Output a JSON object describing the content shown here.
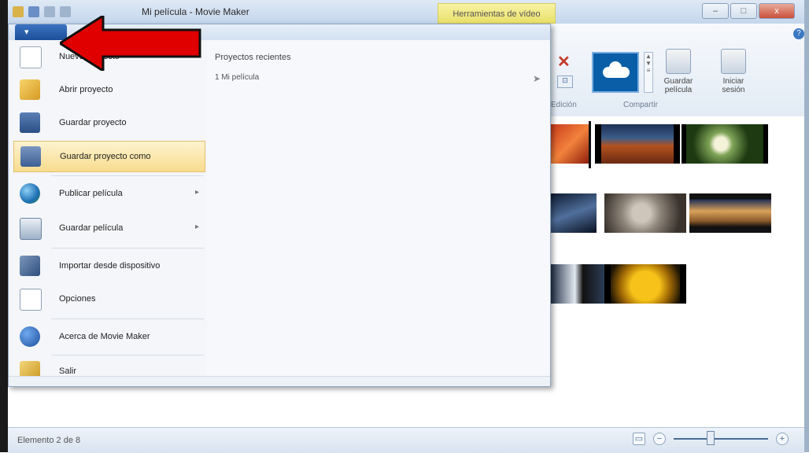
{
  "window": {
    "title": "Mi película - Movie Maker",
    "contextual_tab": "Herramientas de vídeo",
    "controls": {
      "minimize": "–",
      "maximize": "□",
      "close": "x"
    },
    "help_icon": "help-icon"
  },
  "ribbon": {
    "share_group_label": "Compartir",
    "edit_group_label": "Edición",
    "save_movie_button": "Guardar película",
    "sign_in_button": "Iniciar sesión",
    "onedrive_icon": "onedrive-icon"
  },
  "app_menu": {
    "button_label": "▾",
    "items": [
      {
        "label": "Nuevo proyecto",
        "icon": "new-project-icon",
        "has_submenu": false
      },
      {
        "label": "Abrir proyecto",
        "icon": "open-project-icon",
        "has_submenu": false
      },
      {
        "label": "Guardar proyecto",
        "icon": "save-project-icon",
        "has_submenu": false
      },
      {
        "label": "Guardar proyecto como",
        "icon": "save-as-icon",
        "has_submenu": false,
        "highlighted": true
      },
      {
        "label": "Publicar película",
        "icon": "publish-globe-icon",
        "has_submenu": true
      },
      {
        "label": "Guardar película",
        "icon": "save-movie-icon",
        "has_submenu": true
      },
      {
        "label": "Importar desde dispositivo",
        "icon": "import-device-icon",
        "has_submenu": false
      },
      {
        "label": "Opciones",
        "icon": "options-icon",
        "has_submenu": false
      },
      {
        "label": "Acerca de Movie Maker",
        "icon": "info-icon",
        "has_submenu": false
      },
      {
        "label": "Salir",
        "icon": "exit-icon",
        "has_submenu": false
      }
    ],
    "recent_title": "Proyectos recientes",
    "recent_items": [
      {
        "label": "1 Mi película"
      }
    ]
  },
  "status": {
    "text": "Elemento 2 de 8",
    "zoom_minus": "−",
    "zoom_plus": "+"
  },
  "colors": {
    "ribbon_blue": "#1c4f9a",
    "highlight": "#f8dc8e",
    "annotation_arrow": "#e00000"
  }
}
